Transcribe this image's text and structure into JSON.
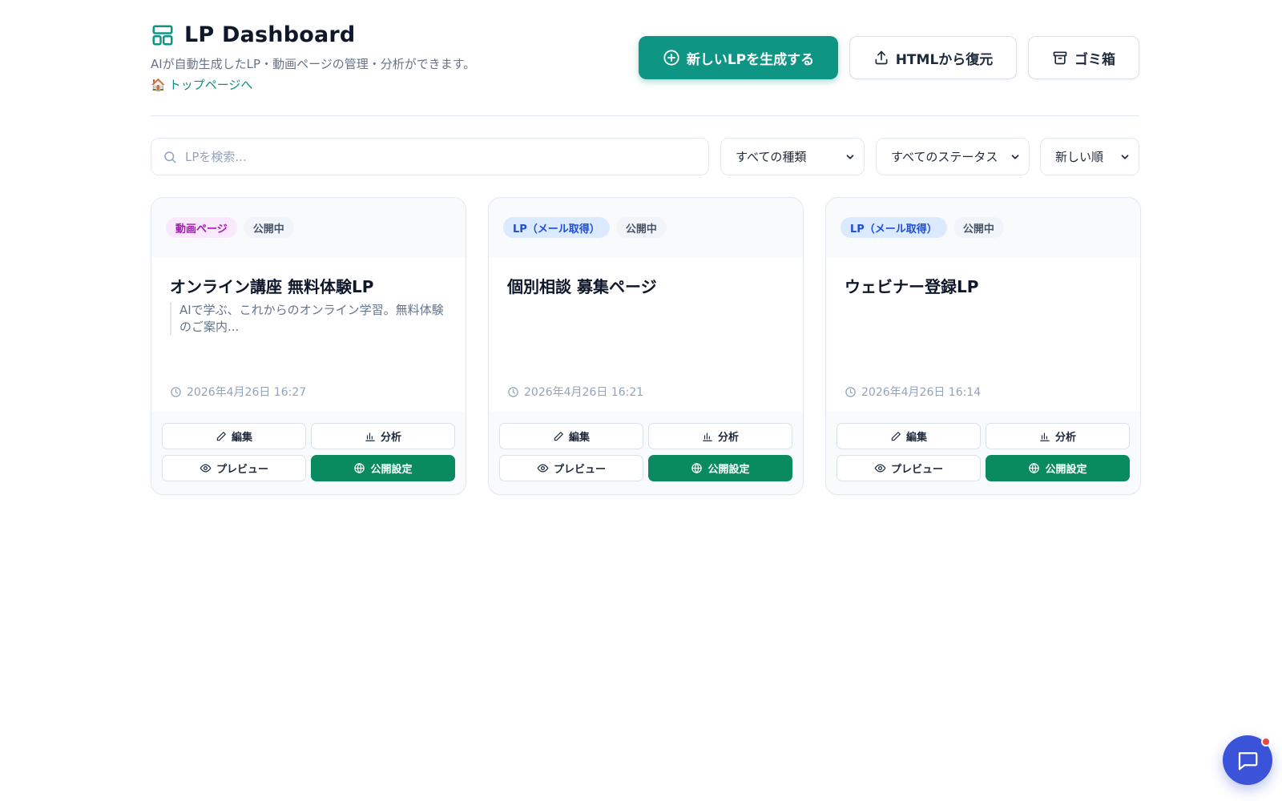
{
  "header": {
    "title": "LP Dashboard",
    "subtitle": "AIが自動生成したLP・動画ページの管理・分析ができます。",
    "top_link_icon": "🏠",
    "top_link": "トップページへ",
    "new_button": "新しいLPを生成する",
    "restore_button": "HTMLから復元",
    "trash_button": "ゴミ箱"
  },
  "filters": {
    "search_placeholder": "LPを検索...",
    "type_select": "すべての種類",
    "status_select": "すべてのステータス",
    "sort_select": "新しい順"
  },
  "cards": [
    {
      "type_badge": "動画ページ",
      "status_badge": "公開中",
      "title": "オンライン講座 無料体験LP",
      "description": "AIで学ぶ、これからのオンライン学習。無料体験のご案内...",
      "date": "2026年4月26日 16:27",
      "edit": "編集",
      "analytics": "分析",
      "preview": "プレビュー",
      "publish": "公開設定"
    },
    {
      "type_badge": "LP（メール取得）",
      "status_badge": "公開中",
      "title": "個別相談 募集ページ",
      "description": "",
      "date": "2026年4月26日 16:21",
      "edit": "編集",
      "analytics": "分析",
      "preview": "プレビュー",
      "publish": "公開設定"
    },
    {
      "type_badge": "LP（メール取得）",
      "status_badge": "公開中",
      "title": "ウェビナー登録LP",
      "description": "",
      "date": "2026年4月26日 16:14",
      "edit": "編集",
      "analytics": "分析",
      "preview": "プレビュー",
      "publish": "公開設定"
    }
  ],
  "colors": {
    "primary": "#0f9584",
    "publish": "#0a8a5f",
    "chat": "#3b53d9",
    "notification": "#ef4444"
  },
  "icons": {
    "logo": "layout-icon",
    "new": "plus-circle-icon",
    "restore": "upload-icon",
    "trash": "archive-icon",
    "search": "search-icon",
    "clock": "clock-icon",
    "edit": "pencil-icon",
    "analytics": "bar-chart-icon",
    "preview": "eye-icon",
    "publish": "globe-icon",
    "chat": "chat-icon"
  }
}
